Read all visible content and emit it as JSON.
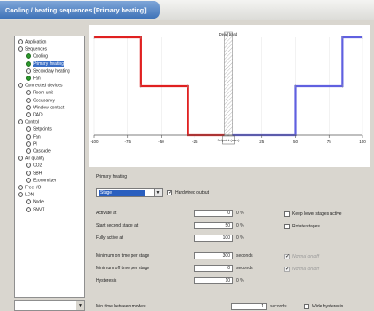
{
  "window": {
    "title": "Cooling / heating sequences [Primary heating]"
  },
  "tree": {
    "items": [
      {
        "label": "Application",
        "level": 0,
        "glyph": "ex",
        "selected": false
      },
      {
        "label": "Sequences",
        "level": 0,
        "glyph": "ex",
        "selected": false
      },
      {
        "label": "Cooling",
        "level": 1,
        "glyph": "green",
        "selected": false
      },
      {
        "label": "Primary heating",
        "level": 1,
        "glyph": "green",
        "selected": true
      },
      {
        "label": "Secondary heating",
        "level": 1,
        "glyph": "ex",
        "selected": false
      },
      {
        "label": "Fan",
        "level": 1,
        "glyph": "green",
        "selected": false
      },
      {
        "label": "Connected devices",
        "level": 0,
        "glyph": "ex",
        "selected": false
      },
      {
        "label": "Room unit",
        "level": 1,
        "glyph": "ex",
        "selected": false
      },
      {
        "label": "Occupancy",
        "level": 1,
        "glyph": "ex",
        "selected": false
      },
      {
        "label": "Window contact",
        "level": 1,
        "glyph": "ex",
        "selected": false
      },
      {
        "label": "DAD",
        "level": 1,
        "glyph": "ex",
        "selected": false
      },
      {
        "label": "Control",
        "level": 0,
        "glyph": "ex",
        "selected": false
      },
      {
        "label": "Setpoints",
        "level": 1,
        "glyph": "ex",
        "selected": false
      },
      {
        "label": "Fan",
        "level": 1,
        "glyph": "ex",
        "selected": false
      },
      {
        "label": "PI",
        "level": 1,
        "glyph": "ex",
        "selected": false
      },
      {
        "label": "Cascade",
        "level": 1,
        "glyph": "ex",
        "selected": false
      },
      {
        "label": "Air quality",
        "level": 0,
        "glyph": "ex",
        "selected": false
      },
      {
        "label": "CO2",
        "level": 1,
        "glyph": "ex",
        "selected": false
      },
      {
        "label": "SBH",
        "level": 1,
        "glyph": "ex",
        "selected": false
      },
      {
        "label": "Economizer",
        "level": 1,
        "glyph": "ex",
        "selected": false
      },
      {
        "label": "Free I/O",
        "level": 0,
        "glyph": "ex",
        "selected": false
      },
      {
        "label": "LON",
        "level": 0,
        "glyph": "ex",
        "selected": false
      },
      {
        "label": "Node",
        "level": 1,
        "glyph": "ex",
        "selected": false
      },
      {
        "label": "SNVT",
        "level": 1,
        "glyph": "ex",
        "selected": false
      }
    ],
    "dropdown_value": ""
  },
  "chart_data": {
    "type": "line",
    "xlim": [
      -100,
      100
    ],
    "x_ticks": [
      -100,
      -75,
      -50,
      -25,
      0,
      25,
      50,
      75,
      100
    ],
    "x_tick_labels": [
      "-100",
      "-75",
      "-50",
      "-25",
      "0",
      "25",
      "50",
      "75",
      "100"
    ],
    "annotations": [
      "Dead band",
      "Setpoint (user)"
    ],
    "series": [
      {
        "color": "#e02020",
        "points": [
          [
            -100,
            100
          ],
          [
            -65,
            100
          ],
          [
            -65,
            50
          ],
          [
            -30,
            50
          ],
          [
            -30,
            0
          ],
          [
            -3,
            0
          ]
        ]
      },
      {
        "color": "#6060e0",
        "points": [
          [
            3,
            0
          ],
          [
            50,
            0
          ],
          [
            50,
            50
          ],
          [
            85,
            50
          ],
          [
            85,
            100
          ],
          [
            100,
            100
          ]
        ]
      }
    ],
    "dead_band": [
      -3,
      3
    ],
    "colors": {
      "heating": "#e02020",
      "cooling": "#6060e0"
    }
  },
  "settings": {
    "group_label": "Primary heating",
    "mode_value": "Stage",
    "hardwired_label": "Hardwired output",
    "hardwired_checked": true,
    "rows": [
      {
        "label": "Activate at",
        "value": "0",
        "unit": "0 %"
      },
      {
        "label": "Start second stage at",
        "value": "50",
        "unit": "0 %"
      },
      {
        "label": "Fully active at",
        "value": "100",
        "unit": "0 %"
      },
      {
        "label": "Minimum on time per stage",
        "value": "300",
        "unit": "seconds"
      },
      {
        "label": "Minimum off time per stage",
        "value": "0",
        "unit": "seconds"
      },
      {
        "label": "Hysteresis",
        "value": "10",
        "unit": "0 %"
      }
    ],
    "right_checks": [
      {
        "label": "Keep lower stages active",
        "checked": false,
        "disabled": false
      },
      {
        "label": "Rotate stages",
        "checked": false,
        "disabled": false
      },
      {
        "label": "Normal on/off",
        "checked": true,
        "disabled": true
      },
      {
        "label": "Normal on/off",
        "checked": true,
        "disabled": true
      }
    ],
    "bottom_label": "Min time between modes",
    "bottom_value": "1",
    "bottom_unit": "seconds",
    "bottom_check_label": "Wide hysteresis"
  }
}
